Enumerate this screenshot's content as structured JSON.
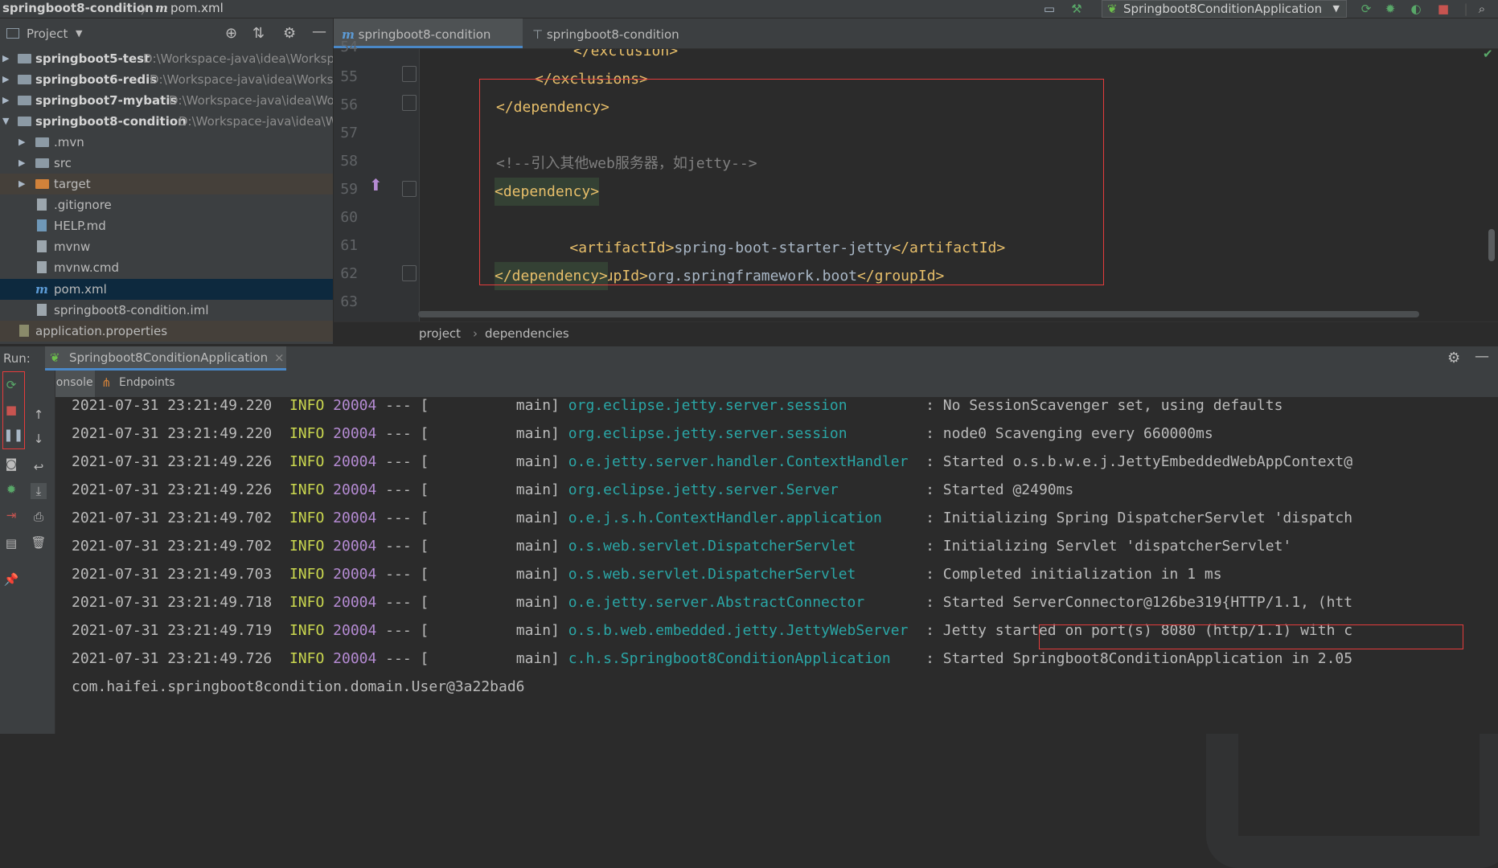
{
  "navbar": {
    "project": "springboot8-condition",
    "separator": "〉",
    "file": "pom.xml",
    "run_config": "Springboot8ConditionApplication"
  },
  "project_panel": {
    "title": "Project",
    "items": [
      {
        "name": "springboot5-test",
        "path": "D:\\Workspace-java\\idea\\Worksp",
        "type": "module",
        "expanded": false
      },
      {
        "name": "springboot6-redis",
        "path": "D:\\Workspace-java\\idea\\Worksp",
        "type": "module",
        "expanded": false
      },
      {
        "name": "springboot7-mybatis",
        "path": "D:\\Workspace-java\\idea\\Wo",
        "type": "module",
        "expanded": false
      },
      {
        "name": "springboot8-condition",
        "path": "D:\\Workspace-java\\idea\\W",
        "type": "module",
        "expanded": true
      },
      {
        "name": ".mvn",
        "type": "folder"
      },
      {
        "name": "src",
        "type": "folder"
      },
      {
        "name": "target",
        "type": "folder-orange"
      },
      {
        "name": ".gitignore",
        "type": "file"
      },
      {
        "name": "HELP.md",
        "type": "file"
      },
      {
        "name": "mvnw",
        "type": "file"
      },
      {
        "name": "mvnw.cmd",
        "type": "file"
      },
      {
        "name": "pom.xml",
        "type": "maven",
        "selected": true
      },
      {
        "name": "springboot8-condition.iml",
        "type": "file"
      },
      {
        "name": "application.properties",
        "type": "file"
      }
    ]
  },
  "editor": {
    "tabs": [
      {
        "label": "springboot8-condition",
        "icon": "maven-m-icon",
        "active": true
      },
      {
        "label": "springboot8-condition",
        "icon": "structure-icon",
        "active": false,
        "close": "×"
      }
    ],
    "line_numbers": [
      "54",
      "55",
      "56",
      "57",
      "58",
      "59",
      "60",
      "61",
      "62",
      "63"
    ],
    "code": {
      "l54": "</exclusion>",
      "l55": "</exclusions>",
      "l56": "</dependency>",
      "l58": "<!--引入其他web服务器，如jetty-->",
      "l59": "<dependency>",
      "l60_open": "<artifactId>",
      "l60_text": "spring-boot-starter-jetty",
      "l60_close": "</artifactId>",
      "l61_open": "<groupId>",
      "l61_text": "org.springframework.boot",
      "l61_close": "</groupId>",
      "l62": "</dependency>"
    },
    "breadcrumb": [
      "project",
      "dependencies"
    ],
    "breadcrumb_sep": "›"
  },
  "run_panel": {
    "label": "Run:",
    "tab": "Springboot8ConditionApplication",
    "tab_close": "×",
    "subtabs": [
      "Console",
      "Endpoints"
    ],
    "log": [
      {
        "ts": "2021-07-31 23:21:49.220",
        "level": "INFO",
        "pid": "20004",
        "sep": "--- [",
        "thread": "main]",
        "logger": "org.eclipse.jetty.server.session",
        "msg": ": No SessionScavenger set, using defaults"
      },
      {
        "ts": "2021-07-31 23:21:49.220",
        "level": "INFO",
        "pid": "20004",
        "sep": "--- [",
        "thread": "main]",
        "logger": "org.eclipse.jetty.server.session",
        "msg": ": node0 Scavenging every 660000ms"
      },
      {
        "ts": "2021-07-31 23:21:49.226",
        "level": "INFO",
        "pid": "20004",
        "sep": "--- [",
        "thread": "main]",
        "logger": "o.e.jetty.server.handler.ContextHandler",
        "msg": ": Started o.s.b.w.e.j.JettyEmbeddedWebAppContext@"
      },
      {
        "ts": "2021-07-31 23:21:49.226",
        "level": "INFO",
        "pid": "20004",
        "sep": "--- [",
        "thread": "main]",
        "logger": "org.eclipse.jetty.server.Server",
        "msg": ": Started @2490ms"
      },
      {
        "ts": "2021-07-31 23:21:49.702",
        "level": "INFO",
        "pid": "20004",
        "sep": "--- [",
        "thread": "main]",
        "logger": "o.e.j.s.h.ContextHandler.application",
        "msg": ": Initializing Spring DispatcherServlet 'dispatch"
      },
      {
        "ts": "2021-07-31 23:21:49.702",
        "level": "INFO",
        "pid": "20004",
        "sep": "--- [",
        "thread": "main]",
        "logger": "o.s.web.servlet.DispatcherServlet",
        "msg": ": Initializing Servlet 'dispatcherServlet'"
      },
      {
        "ts": "2021-07-31 23:21:49.703",
        "level": "INFO",
        "pid": "20004",
        "sep": "--- [",
        "thread": "main]",
        "logger": "o.s.web.servlet.DispatcherServlet",
        "msg": ": Completed initialization in 1 ms"
      },
      {
        "ts": "2021-07-31 23:21:49.718",
        "level": "INFO",
        "pid": "20004",
        "sep": "--- [",
        "thread": "main]",
        "logger": "o.e.jetty.server.AbstractConnector",
        "msg": ": Started ServerConnector@126be319{HTTP/1.1, (htt"
      },
      {
        "ts": "2021-07-31 23:21:49.719",
        "level": "INFO",
        "pid": "20004",
        "sep": "--- [",
        "thread": "main]",
        "logger": "o.s.b.web.embedded.jetty.JettyWebServer",
        "msg": ": Jetty started on port(s) 8080 (http/1.1) with c"
      },
      {
        "ts": "2021-07-31 23:21:49.726",
        "level": "INFO",
        "pid": "20004",
        "sep": "--- [",
        "thread": "main]",
        "logger": "c.h.s.Springboot8ConditionApplication",
        "msg": ": Started Springboot8ConditionApplication in 2.05"
      }
    ],
    "stdout": "com.haifei.springboot8condition.domain.User@3a22bad6"
  },
  "colors": {
    "accent": "#4a88c7",
    "highlight_box": "#e53c3c",
    "log_level": "#cbd84f",
    "log_pid": "#b58bd3",
    "log_logger": "#2aa6a6",
    "xml_tag": "#e8bf6a",
    "comment": "#808080"
  }
}
